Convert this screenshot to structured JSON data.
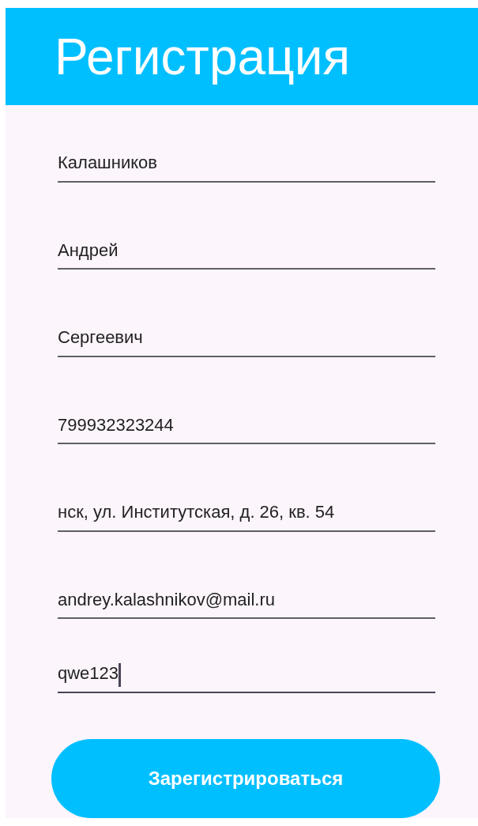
{
  "header": {
    "title": "Регистрация"
  },
  "fields": [
    {
      "value": "Калашников",
      "focused": false
    },
    {
      "value": "Андрей",
      "focused": false
    },
    {
      "value": "Сергеевич",
      "focused": false
    },
    {
      "value": "799932323244",
      "focused": false
    },
    {
      "value": "нск, ул. Институтская, д. 26, кв. 54",
      "focused": false
    },
    {
      "value": "andrey.kalashnikov@mail.ru",
      "focused": false
    },
    {
      "value": "qwe123",
      "focused": true
    }
  ],
  "submit_button": {
    "label": "Зарегистрироваться"
  }
}
